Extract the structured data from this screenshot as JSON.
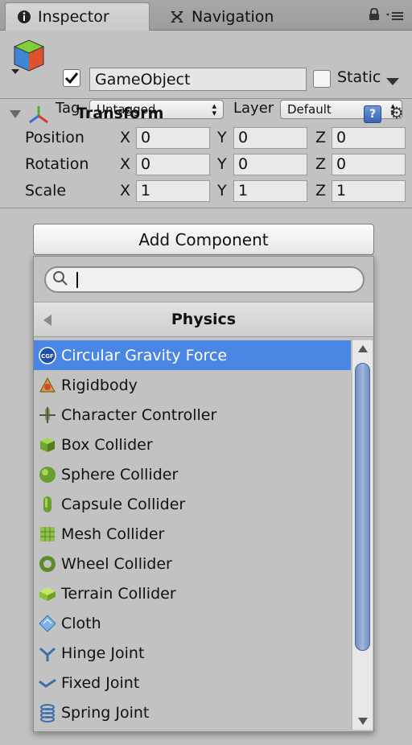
{
  "tabs": [
    {
      "label": "Inspector",
      "icon": "info-icon"
    },
    {
      "label": "Navigation",
      "icon": "navigation-icon"
    }
  ],
  "header": {
    "object_name": "GameObject",
    "active": true,
    "static_label": "Static",
    "static": false,
    "tag_label": "Tag",
    "tag_value": "Untagged",
    "layer_label": "Layer",
    "layer_value": "Default"
  },
  "transform": {
    "title": "Transform",
    "rows": [
      {
        "label": "Position",
        "x": "0",
        "y": "0",
        "z": "0"
      },
      {
        "label": "Rotation",
        "x": "0",
        "y": "0",
        "z": "0"
      },
      {
        "label": "Scale",
        "x": "1",
        "y": "1",
        "z": "1"
      }
    ],
    "axes": {
      "x": "X",
      "y": "Y",
      "z": "Z"
    }
  },
  "add_component": {
    "button_label": "Add Component",
    "search_value": "",
    "category": "Physics",
    "items": [
      {
        "label": "Circular Gravity Force",
        "icon": "cgf-icon",
        "selected": true
      },
      {
        "label": "Rigidbody",
        "icon": "rigidbody-icon"
      },
      {
        "label": "Character Controller",
        "icon": "character-controller-icon"
      },
      {
        "label": "Box Collider",
        "icon": "box-collider-icon"
      },
      {
        "label": "Sphere Collider",
        "icon": "sphere-collider-icon"
      },
      {
        "label": "Capsule Collider",
        "icon": "capsule-collider-icon"
      },
      {
        "label": "Mesh Collider",
        "icon": "mesh-collider-icon"
      },
      {
        "label": "Wheel Collider",
        "icon": "wheel-collider-icon"
      },
      {
        "label": "Terrain Collider",
        "icon": "terrain-collider-icon"
      },
      {
        "label": "Cloth",
        "icon": "cloth-icon"
      },
      {
        "label": "Hinge Joint",
        "icon": "hinge-joint-icon"
      },
      {
        "label": "Fixed Joint",
        "icon": "fixed-joint-icon"
      },
      {
        "label": "Spring Joint",
        "icon": "spring-joint-icon"
      }
    ]
  },
  "colors": {
    "selection": "#4a86e4",
    "panel": "#c2c2c2"
  }
}
